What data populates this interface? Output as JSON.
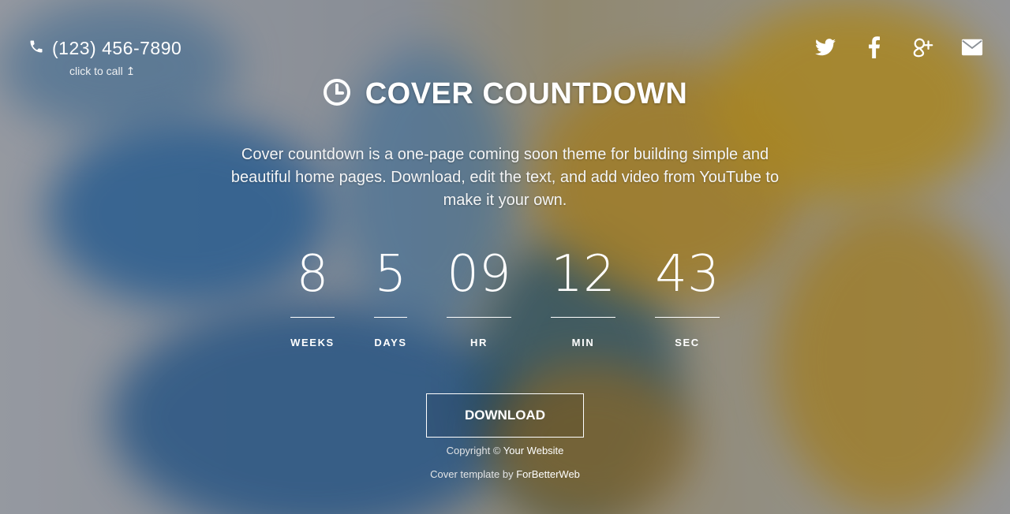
{
  "phone": {
    "number": "(123) 456-7890",
    "hint": "click to call",
    "hint_icon": "↥"
  },
  "socials": [
    {
      "name": "twitter-icon"
    },
    {
      "name": "facebook-icon"
    },
    {
      "name": "google-plus-icon"
    },
    {
      "name": "email-icon"
    }
  ],
  "header": {
    "title": "COVER COUNTDOWN",
    "icon": "clock-icon"
  },
  "description": "Cover countdown is a one-page coming soon theme for building simple and beautiful home pages. Download, edit the text, and add video from YouTube to make it your own.",
  "countdown": [
    {
      "value": "8",
      "label": "WEEKS"
    },
    {
      "value": "5",
      "label": "DAYS"
    },
    {
      "value": "09",
      "label": "HR"
    },
    {
      "value": "12",
      "label": "MIN"
    },
    {
      "value": "43",
      "label": "SEC"
    }
  ],
  "download_label": "DOWNLOAD",
  "footer": {
    "copyright_prefix": "Copyright ©",
    "copyright_link": "Your Website",
    "template_prefix": "Cover template by",
    "template_link": "ForBetterWeb"
  },
  "colors": {
    "ink_blue": "#1f6fae",
    "ink_yellow": "#e0a800"
  }
}
